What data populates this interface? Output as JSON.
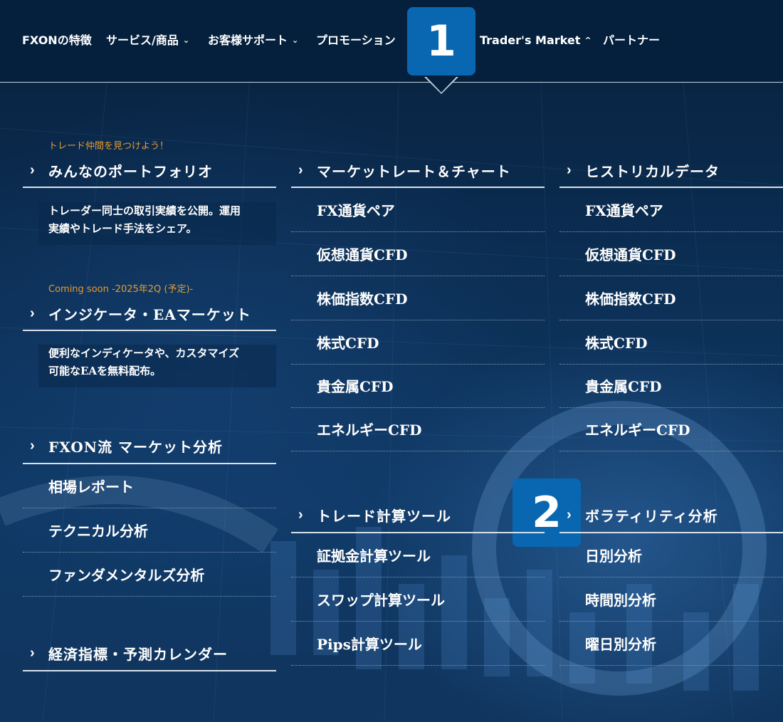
{
  "nav": {
    "items": [
      {
        "label": "FXONの特徴",
        "has_chevron": false
      },
      {
        "label": "サービス/商品",
        "has_chevron": true,
        "chevron": "⌄"
      },
      {
        "label": "お客様サポート",
        "has_chevron": true,
        "chevron": "⌄"
      },
      {
        "label": "プロモーション",
        "has_chevron": false
      },
      {
        "label": "Trader's Market",
        "has_chevron": true,
        "chevron": "^"
      },
      {
        "label": "パートナー",
        "has_chevron": false
      }
    ]
  },
  "badges": [
    "1",
    "2"
  ],
  "left_column": {
    "portfolio": {
      "tag": "トレード仲間を見つけよう！",
      "title": "みんなのポートフォリオ",
      "desc_line1": "トレーダー同士の取引実績を公開。運用",
      "desc_line2": "実績やトレード手法をシェア。"
    },
    "indicator": {
      "tag": "Coming soon -2025年2Q (予定)-",
      "title": "インジケータ・EAマーケット",
      "desc_line1": "便利なインディケータや、カスタマイズ",
      "desc_line2": "可能なEAを無料配布。"
    },
    "analysis": {
      "title": "FXON流 マーケット分析",
      "items": [
        "相場レポート",
        "テクニカル分析",
        "ファンダメンタルズ分析"
      ]
    },
    "calendar": {
      "title": "経済指標・予測カレンダー"
    }
  },
  "middle_column": {
    "rates": {
      "title": "マーケットレート＆チャート",
      "items": [
        "FX通貨ペア",
        "仮想通貨CFD",
        "株価指数CFD",
        "株式CFD",
        "貴金属CFD",
        "エネルギーCFD"
      ]
    },
    "tools": {
      "title": "トレード計算ツール",
      "items": [
        "証拠金計算ツール",
        "スワップ計算ツール",
        "Pips計算ツール"
      ]
    }
  },
  "right_column": {
    "historical": {
      "title": "ヒストリカルデータ",
      "items": [
        "FX通貨ペア",
        "仮想通貨CFD",
        "株価指数CFD",
        "株式CFD",
        "貴金属CFD",
        "エネルギーCFD"
      ]
    },
    "volatility": {
      "title": "ボラティリティ分析",
      "items": [
        "日別分析",
        "時間別分析",
        "曜日別分析"
      ]
    }
  },
  "icons": {
    "section_arrow": "›"
  },
  "colors": {
    "nav_bg": "#04203c",
    "badge_bg": "#0867b0",
    "tag_orange": "#e79a2e",
    "divider": "#d9e1ea"
  }
}
